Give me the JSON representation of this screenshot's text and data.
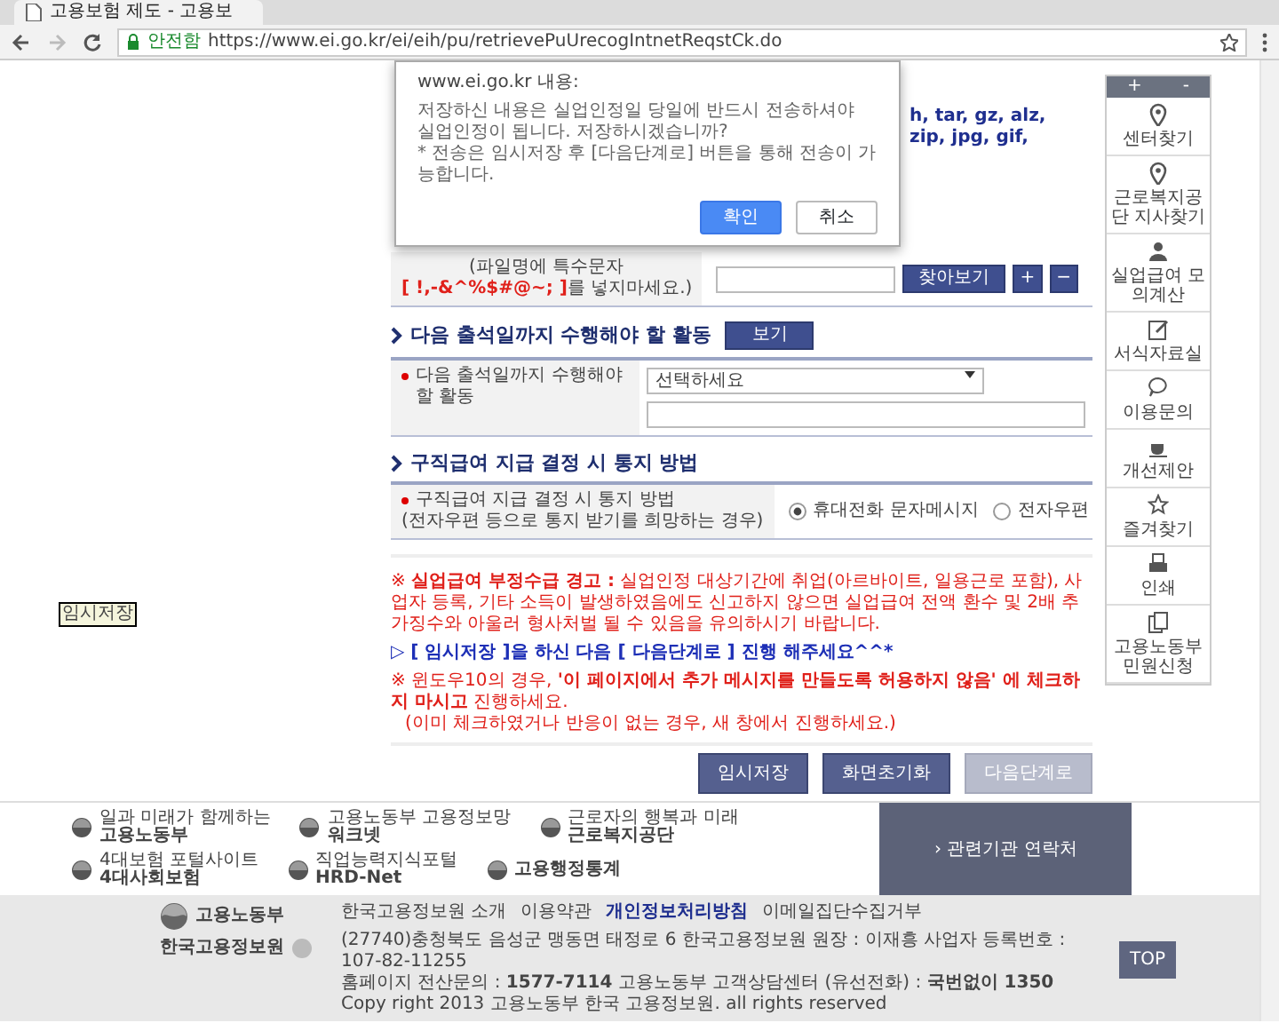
{
  "browser": {
    "tab_title": "고용보험 제도 - 고용보",
    "secure_label": "안전함",
    "url": "https://www.ei.go.kr/ei/eih/pu/retrievePuUrecogIntnetReqstCk.do"
  },
  "dialog": {
    "title": "www.ei.go.kr 내용:",
    "message": [
      "저장하신 내용은 실업인정일 당일에 반드시 전송하셔야",
      "실업인정이 됩니다. 저장하시겠습니까?",
      "* 전송은 임시저장 후 [다음단계로] 버튼을 통해 전송이 가능합니다."
    ],
    "buttons": [
      {
        "label": "확인",
        "primary": true
      },
      {
        "label": "취소",
        "primary": false
      }
    ]
  },
  "extensions_text": "h, tar, gz, alz, zip, jpg, gif,",
  "file_row": {
    "note": "(파일명에 특수문자",
    "forbidden_chars": "[ !,-&^%$#@~; ]",
    "note_end": "를 넣지마세요.)",
    "browse_button": "찾아보기",
    "add_button": "+",
    "remove_button": "−"
  },
  "activity_section": {
    "title": "다음 출석일까지 수행해야 할 활동",
    "view_button": "보기",
    "label": "다음 출석일까지 수행해야 할 활동",
    "select": "선택하세요",
    "required": true
  },
  "notice_section": {
    "title": "구직급여 지급 결정 시 통지 방법",
    "label": "구직급여 지급 결정 시 통지 방법",
    "sublabel": "(전자우편 등으로 통지 받기를 희망하는 경우)",
    "required": true,
    "options": [
      {
        "label": "휴대전화 문자메시지",
        "selected": true
      },
      {
        "label": "전자우편",
        "selected": false
      }
    ]
  },
  "warnings": [
    {
      "kind": "red",
      "text": "※ **실업급여 부정수급 경고 :** 실업인정 대상기간에 취업(아르바이트, 일용근로 포함), 사업자 등록, 기타 소득이 발생하였음에도 신고하지 않으면 실업급여 전액 환수 및 2배 추가징수와 아울러 형사처벌 될 수 있음을 유의하시기 바랍니다."
    },
    {
      "kind": "blue",
      "text": "▷ [ 임시저장 ]을 하신 다음 [ 다음단계로 ] 진행 해주세요^^*"
    },
    {
      "kind": "red",
      "text": "※ 윈도우10의 경우, **'이 페이지에서 추가 메시지를 만들도록 허용하지 않음' 에 체크하지 마시고** 진행하세요."
    },
    {
      "kind": "red-sub",
      "text": "(이미 체크하였거나 반응이 없는 경우, 새 창에서 진행하세요.)"
    }
  ],
  "actions": [
    {
      "label": "임시저장",
      "disabled": false
    },
    {
      "label": "화면초기화",
      "disabled": false
    },
    {
      "label": "다음단계로",
      "disabled": true
    }
  ],
  "floating_label": "임시저장",
  "quick_menu": {
    "expand": "+",
    "collapse": "-",
    "items": [
      {
        "kind": "pin",
        "label": "센터찾기"
      },
      {
        "kind": "pin",
        "label": "근로복지공단 지사찾기"
      },
      {
        "kind": "person",
        "label": "실업급여 모의계산"
      },
      {
        "kind": "pencil",
        "label": "서식자료실"
      },
      {
        "kind": "chat",
        "label": "이용문의"
      },
      {
        "kind": "cup",
        "label": "개선제안"
      },
      {
        "kind": "star",
        "label": "즐겨찾기"
      },
      {
        "kind": "printer",
        "label": "인쇄"
      },
      {
        "kind": "docs",
        "label": "고용노동부 민원신청"
      }
    ]
  },
  "partner_logos": [
    {
      "sub": "일과 미래가 함께하는",
      "name": "고용노동부"
    },
    {
      "sub": "고용노동부 고용정보망",
      "name": "워크넷"
    },
    {
      "sub": "근로자의 행복과 미래",
      "name": "근로복지공단"
    },
    {
      "sub": "4대보험 포털사이트",
      "name": "4대사회보험"
    },
    {
      "sub": "직업능력지식포털",
      "name": "HRD-Net"
    },
    {
      "name": "고용행정통계"
    }
  ],
  "contacts_button": "› 관련기관 연락처",
  "footer": {
    "ministry": "고용노동부",
    "institute": "한국고용정보원",
    "links": [
      {
        "label": "한국고용정보원 소개",
        "emphasis": false
      },
      {
        "label": "이용약관",
        "emphasis": false
      },
      {
        "label": "개인정보처리방침",
        "emphasis": true
      },
      {
        "label": "이메일집단수집거부",
        "emphasis": false
      }
    ],
    "address": "(27740)충청북도 음성군 맹동면 태정로 6 한국고용정보원   원장 : 이재흥   사업자 등록번호 : 107-82-11255",
    "contact": "홈페이지 전산문의 : **1577-7114**   고용노동부 고객상담센터 (유선전화) : **국번없이 1350**",
    "copyright": "Copy right 2013 고용노동부 한국 고용정보원. all rights reserved",
    "top_button": "TOP"
  }
}
